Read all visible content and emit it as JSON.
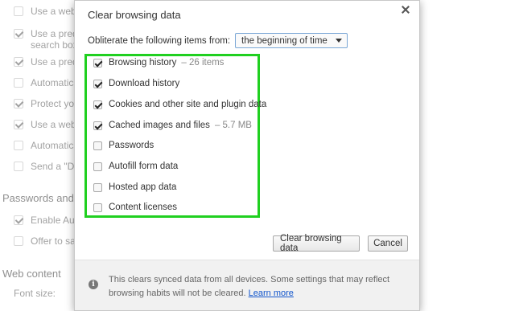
{
  "background": {
    "items": [
      {
        "label": "Use a web se",
        "checked": false
      },
      {
        "label": "Use a predict",
        "label2": "search box",
        "checked": true
      },
      {
        "label": "Use a predict",
        "checked": true
      },
      {
        "label": "Automaticall",
        "checked": false
      },
      {
        "label": "Protect you a",
        "checked": true
      },
      {
        "label": "Use a web se",
        "checked": true
      },
      {
        "label": "Automaticall",
        "checked": false
      },
      {
        "label": "Send a \"Do N",
        "checked": false
      }
    ],
    "section_passwords": "Passwords and fo",
    "enable_autofill": "Enable Autof",
    "offer_to_save": "Offer to save",
    "section_web_content": "Web content",
    "font_size": "Font size:"
  },
  "dialog": {
    "title": "Clear browsing data",
    "period_label": "Obliterate the following items from:",
    "period_value": "the beginning of time",
    "options": [
      {
        "label": "Browsing history",
        "extra": "– 26 items",
        "checked": true
      },
      {
        "label": "Download history",
        "extra": "",
        "checked": true
      },
      {
        "label": "Cookies and other site and plugin data",
        "extra": "",
        "checked": true
      },
      {
        "label": "Cached images and files",
        "extra": "– 5.7 MB",
        "checked": true
      },
      {
        "label": "Passwords",
        "extra": "",
        "checked": false
      },
      {
        "label": "Autofill form data",
        "extra": "",
        "checked": false
      },
      {
        "label": "Hosted app data",
        "extra": "",
        "checked": false
      },
      {
        "label": "Content licenses",
        "extra": "",
        "checked": false
      }
    ],
    "clear_button": "Clear browsing data",
    "cancel_button": "Cancel",
    "footer_text": "This clears synced data from all devices. Some settings that may reflect browsing habits will not be cleared.",
    "footer_link": "Learn more"
  },
  "colors": {
    "highlight": "#20d020",
    "link": "#1155cc"
  }
}
